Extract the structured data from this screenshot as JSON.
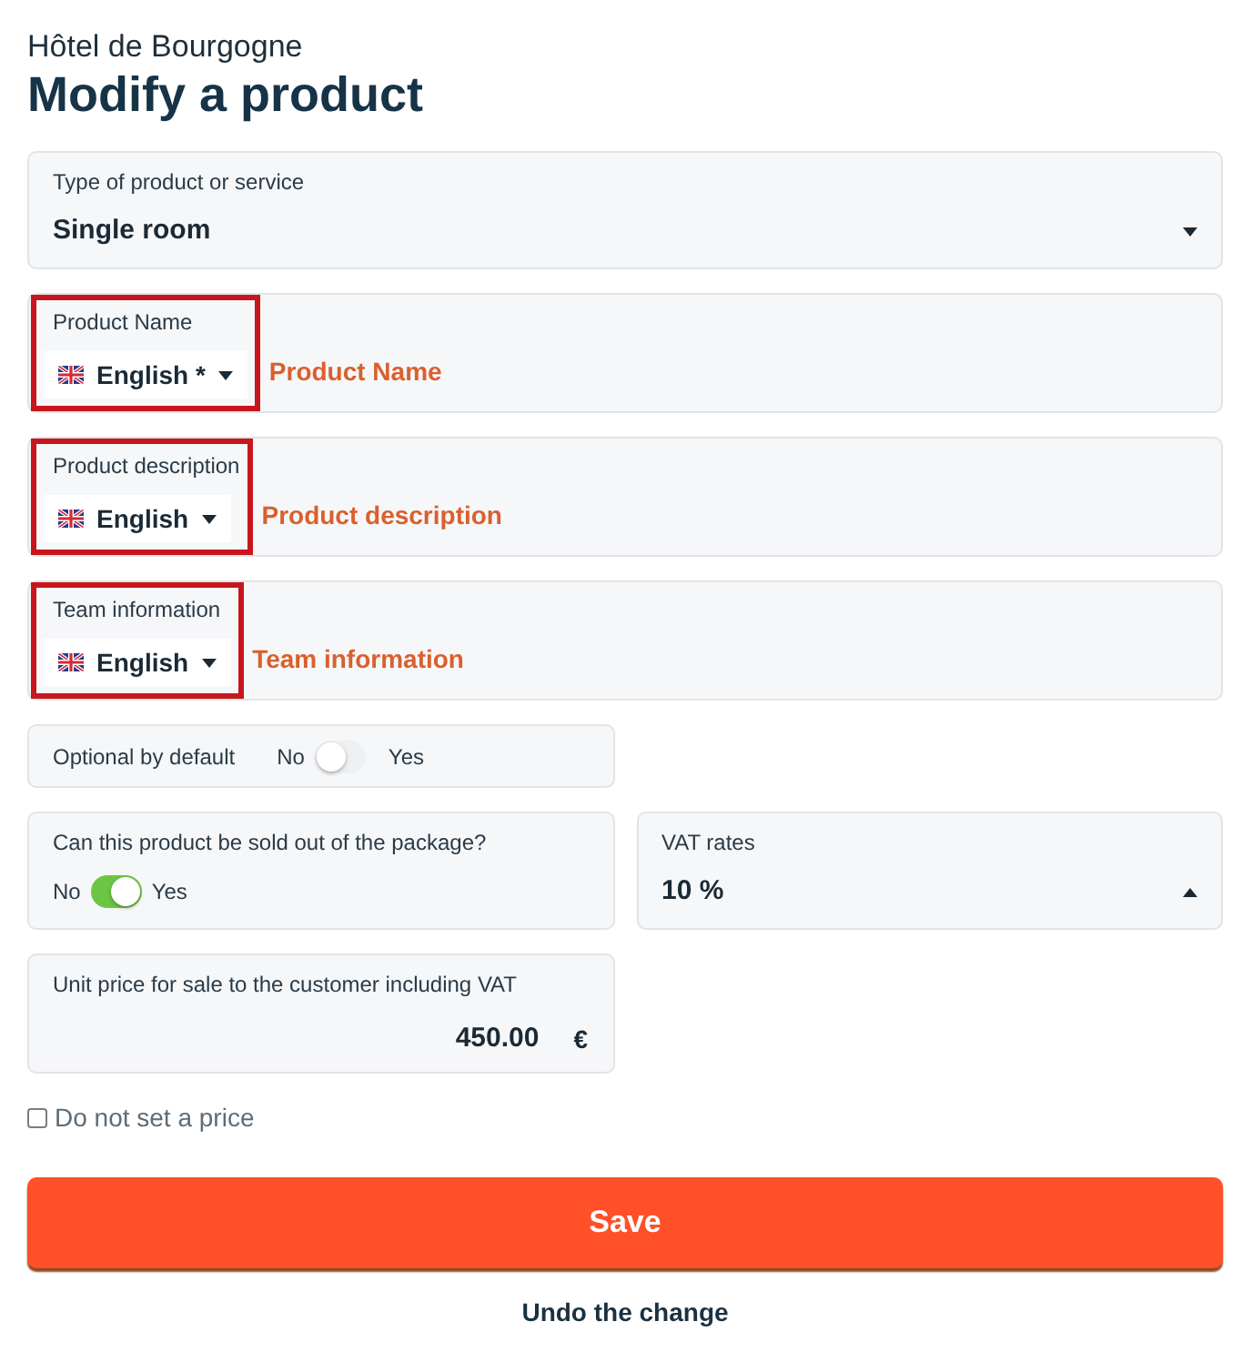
{
  "header": {
    "subtitle": "Hôtel de Bourgogne",
    "title": "Modify a product"
  },
  "product_type": {
    "label": "Type of product or service",
    "value": "Single room",
    "expanded": false
  },
  "translated_fields": [
    {
      "label": "Product Name",
      "language": "English *",
      "annotation": "Product Name",
      "highlighted": true
    },
    {
      "label": "Product description",
      "language": "English",
      "annotation": "Product description",
      "highlighted": true
    },
    {
      "label": "Team information",
      "language": "English",
      "annotation": "Team information",
      "highlighted": true
    }
  ],
  "optional_by_default": {
    "label": "Optional by default",
    "off_label": "No",
    "on_label": "Yes",
    "on": false
  },
  "sold_out_of_package": {
    "label": "Can this product be sold out of the package?",
    "off_label": "No",
    "on_label": "Yes",
    "on": true
  },
  "vat_rates": {
    "label": "VAT rates",
    "value": "10 %",
    "expanded": true
  },
  "unit_price": {
    "label": "Unit price for sale to the customer including VAT",
    "value": "450.00",
    "currency": "€"
  },
  "no_price": {
    "label": "Do not set a price",
    "checked": false
  },
  "buttons": {
    "save": "Save",
    "undo": "Undo the change"
  }
}
